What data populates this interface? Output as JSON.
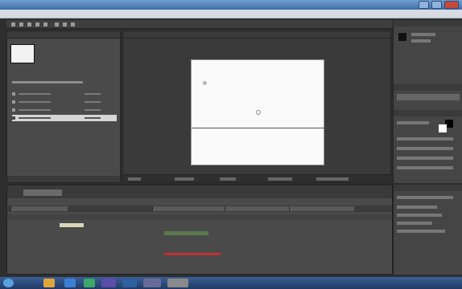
{
  "window": {
    "title": ""
  },
  "menu": {
    "items": [
      "",
      "",
      "",
      "",
      "",
      "",
      "",
      "",
      "",
      ""
    ]
  },
  "project": {
    "name": "",
    "details": ""
  },
  "composition": {
    "tab": "",
    "zoom": ""
  },
  "timeline": {
    "tab": "",
    "layers": [
      "",
      ""
    ]
  },
  "colors": {
    "accent": "#3f6fa8",
    "panel": "#4a4a4a",
    "canvas": "#fafafa",
    "layer_bar": "#d7d7b8",
    "layer_bar_2": "#5c7a4c",
    "alert": "#c03030"
  },
  "taskbar": {
    "apps": [
      "start-orb-icon",
      "explorer-icon",
      "browser-icon",
      "media-icon",
      "aftereffects-icon",
      "photoshop-icon",
      "folder-icon"
    ],
    "clock": ""
  }
}
